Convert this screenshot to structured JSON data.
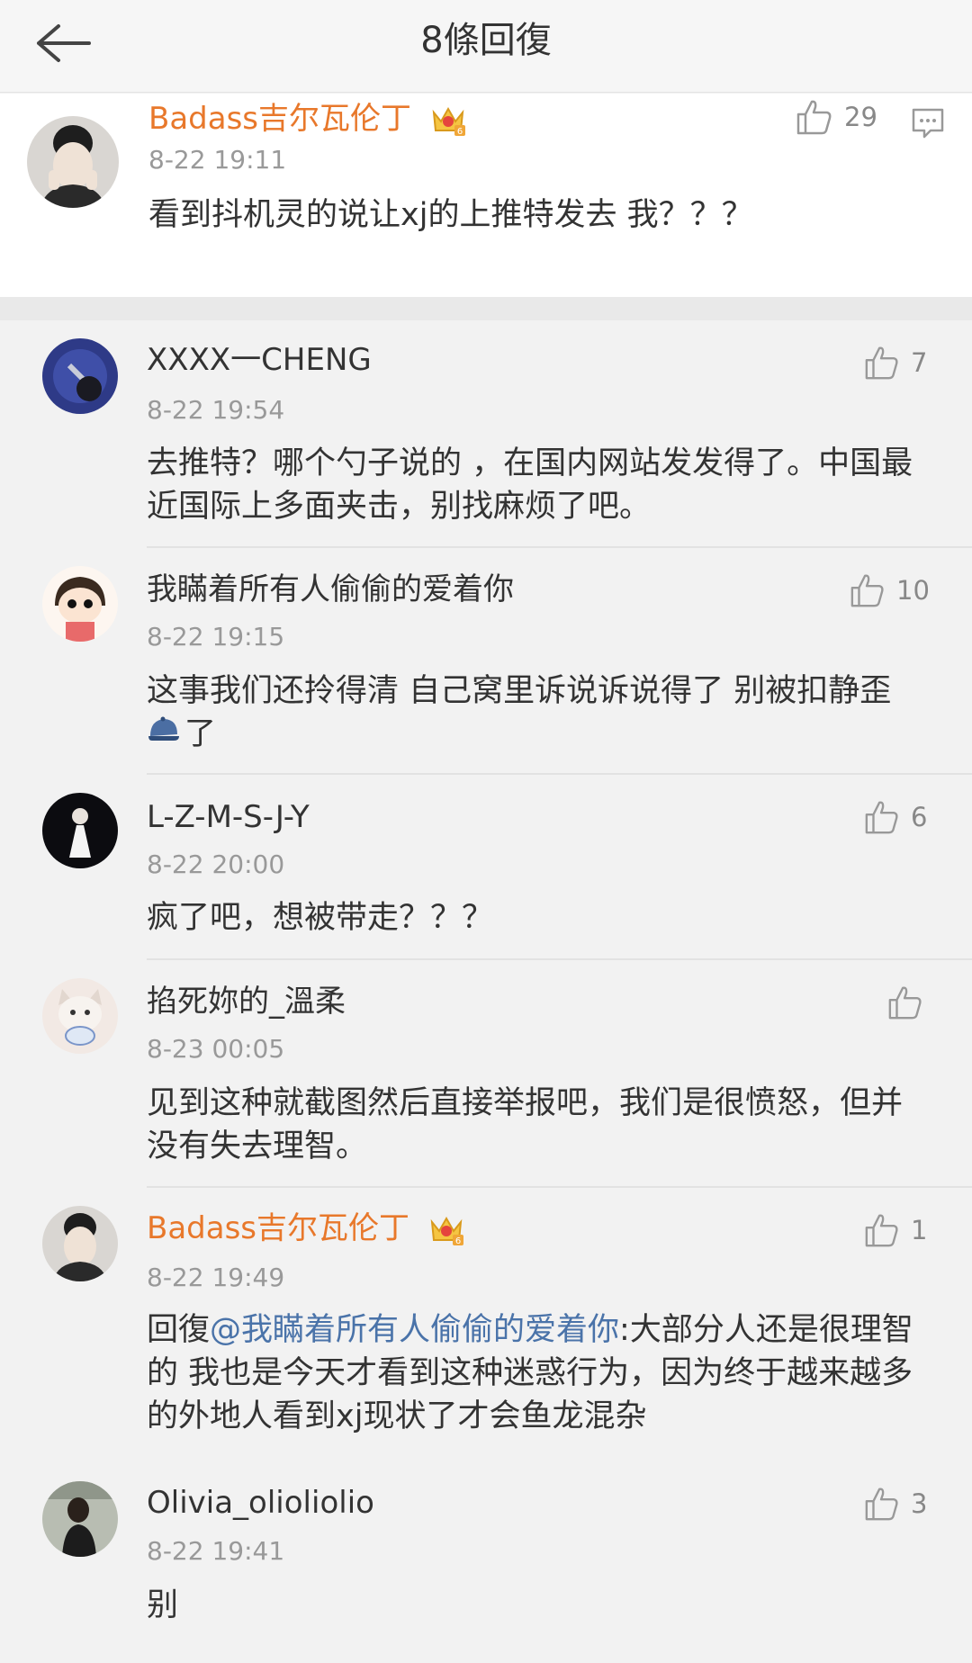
{
  "header": {
    "title": "8條回復"
  },
  "main_comment": {
    "user": "Badass吉尔瓦伦丁",
    "badge_level": "6",
    "time": "8-22 19:11",
    "text": "看到抖机灵的说让xj的上推特发去 我？？？",
    "likes": "29"
  },
  "replies": [
    {
      "user": "XXXX一CHENG",
      "time": "8-22 19:54",
      "line1": "去推特？哪个勺子说的 ，在国内网站发发得了。中国最",
      "line2": "近国际上多面夹击，别找麻烦了吧。",
      "likes": "7"
    },
    {
      "user": "我瞞着所有人偷偷的爱着你",
      "time": "8-22 19:15",
      "line1": "这事我们还拎得清  自己窝里诉说诉说得了  别被扣静歪",
      "line2": "了",
      "likes": "10"
    },
    {
      "user": "L-Z-M-S-J-Y",
      "time": "8-22 20:00",
      "line1": "疯了吧，想被带走？？？",
      "likes": "6"
    },
    {
      "user": "掐死妳的_溫柔",
      "time": "8-23 00:05",
      "line1": "见到这种就截图然后直接举报吧，我们是很愤怒，但并",
      "line2": "没有失去理智。",
      "likes": ""
    },
    {
      "user": "Badass吉尔瓦伦丁",
      "badge_level": "6",
      "time": "8-22 19:49",
      "reply_prefix": "回復",
      "mention": "@我瞞着所有人偷偷的爱着你",
      "line1_rest": ":大部分人还是很理智",
      "line2": "的 我也是今天才看到这种迷惑行为，因为终于越来越多",
      "line3": "的外地人看到xj现状了才会鱼龙混杂",
      "likes": "1"
    },
    {
      "user": "Olivia_olioliolio",
      "time": "8-22 19:41",
      "line1": "别",
      "likes": "3"
    }
  ],
  "colors": {
    "accent_orange": "#e8782b",
    "mention_blue": "#4a73a9",
    "badge_gold": "#f5c542"
  }
}
